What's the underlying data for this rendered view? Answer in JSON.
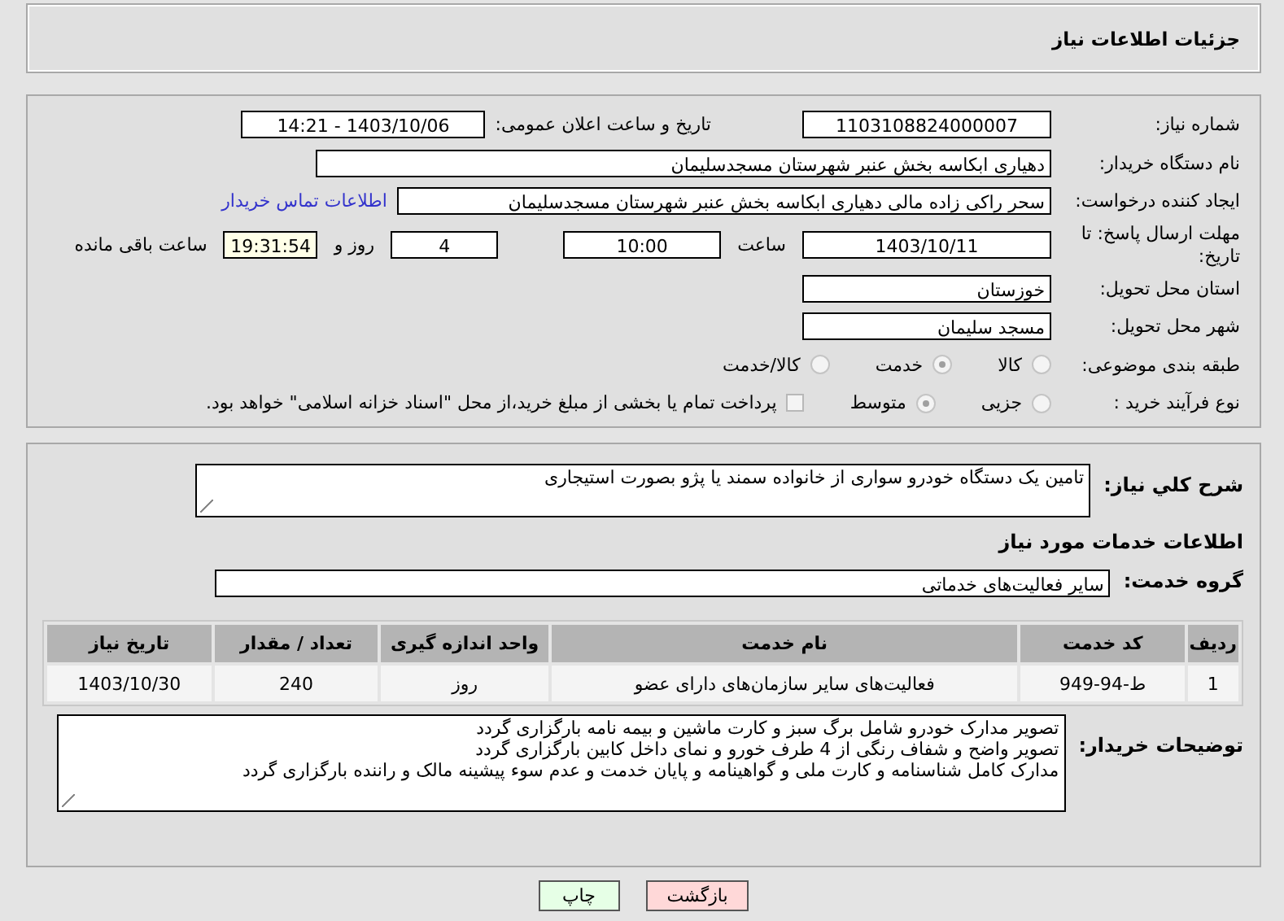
{
  "header": {
    "title": "جزئیات اطلاعات نیاز"
  },
  "form": {
    "need_number": {
      "label": "شماره نیاز:",
      "value": "1103108824000007"
    },
    "announce": {
      "label": "تاریخ و ساعت اعلان عمومی:",
      "value": "1403/10/06 - 14:21"
    },
    "buyer_org": {
      "label": "نام دستگاه خریدار:",
      "value": "دهیاری ابکاسه بخش عنبر شهرستان مسجدسلیمان"
    },
    "requester": {
      "label": "ایجاد کننده درخواست:",
      "value": "سحر راکی زاده مالی دهیاری ابکاسه بخش عنبر شهرستان مسجدسلیمان",
      "link": "اطلاعات تماس خریدار"
    },
    "deadline": {
      "label": "مهلت ارسال پاسخ: تا تاریخ:",
      "date": "1403/10/11",
      "time_label": "ساعت",
      "time": "10:00",
      "days": "4",
      "days_label": "روز و",
      "remaining": "19:31:54",
      "remaining_label": "ساعت باقی مانده"
    },
    "province": {
      "label": "استان محل تحویل:",
      "value": "خوزستان"
    },
    "city": {
      "label": "شهر محل تحویل:",
      "value": "مسجد سلیمان"
    },
    "category": {
      "label": "طبقه بندی موضوعی:",
      "options": [
        {
          "label": "کالا",
          "selected": false
        },
        {
          "label": "خدمت",
          "selected": true
        },
        {
          "label": "کالا/خدمت",
          "selected": false
        }
      ]
    },
    "process": {
      "label": "نوع فرآیند خرید :",
      "options": [
        {
          "label": "جزیی",
          "selected": false
        },
        {
          "label": "متوسط",
          "selected": true
        }
      ],
      "payment": {
        "label": "پرداخت تمام یا بخشی از مبلغ خرید،از محل \"اسناد خزانه اسلامی\" خواهد بود.",
        "checked": false
      }
    }
  },
  "details": {
    "summary": {
      "label": "شرح كلي نياز:",
      "value": "تامین یک دستگاه خودرو سواری  از خانواده سمند یا پژو بصورت استیجاری"
    },
    "services_title": "اطلاعات خدمات مورد نیاز",
    "service_group": {
      "label": "گروه خدمت:",
      "value": "سایر فعالیت‌های خدماتی"
    },
    "table": {
      "columns": [
        "ردیف",
        "کد خدمت",
        "نام خدمت",
        "واحد اندازه گیری",
        "تعداد / مقدار",
        "تاریخ نیاز"
      ],
      "rows": [
        [
          "1",
          "ط-94-949",
          "فعالیت‌های سایر سازمان‌های دارای عضو",
          "روز",
          "240",
          "1403/10/30"
        ]
      ]
    },
    "buyer_notes": {
      "label": "توضیحات خریدار:",
      "lines": [
        "تصویر مدارک خودرو شامل برگ سبز و کارت ماشین و بیمه نامه بارگزاری گردد",
        "تصویر واضح و شفاف رنگی از 4 طرف خورو و نمای داخل کابین بارگزاری گردد",
        "مدارک کامل شناسنامه و کارت ملی و گواهینامه و پایان خدمت و عدم سوء پیشینه مالک و راننده بارگزاری گردد"
      ]
    }
  },
  "buttons": [
    {
      "label": "بازگشت",
      "kind": "back"
    },
    {
      "label": "چاپ",
      "kind": "print"
    }
  ]
}
